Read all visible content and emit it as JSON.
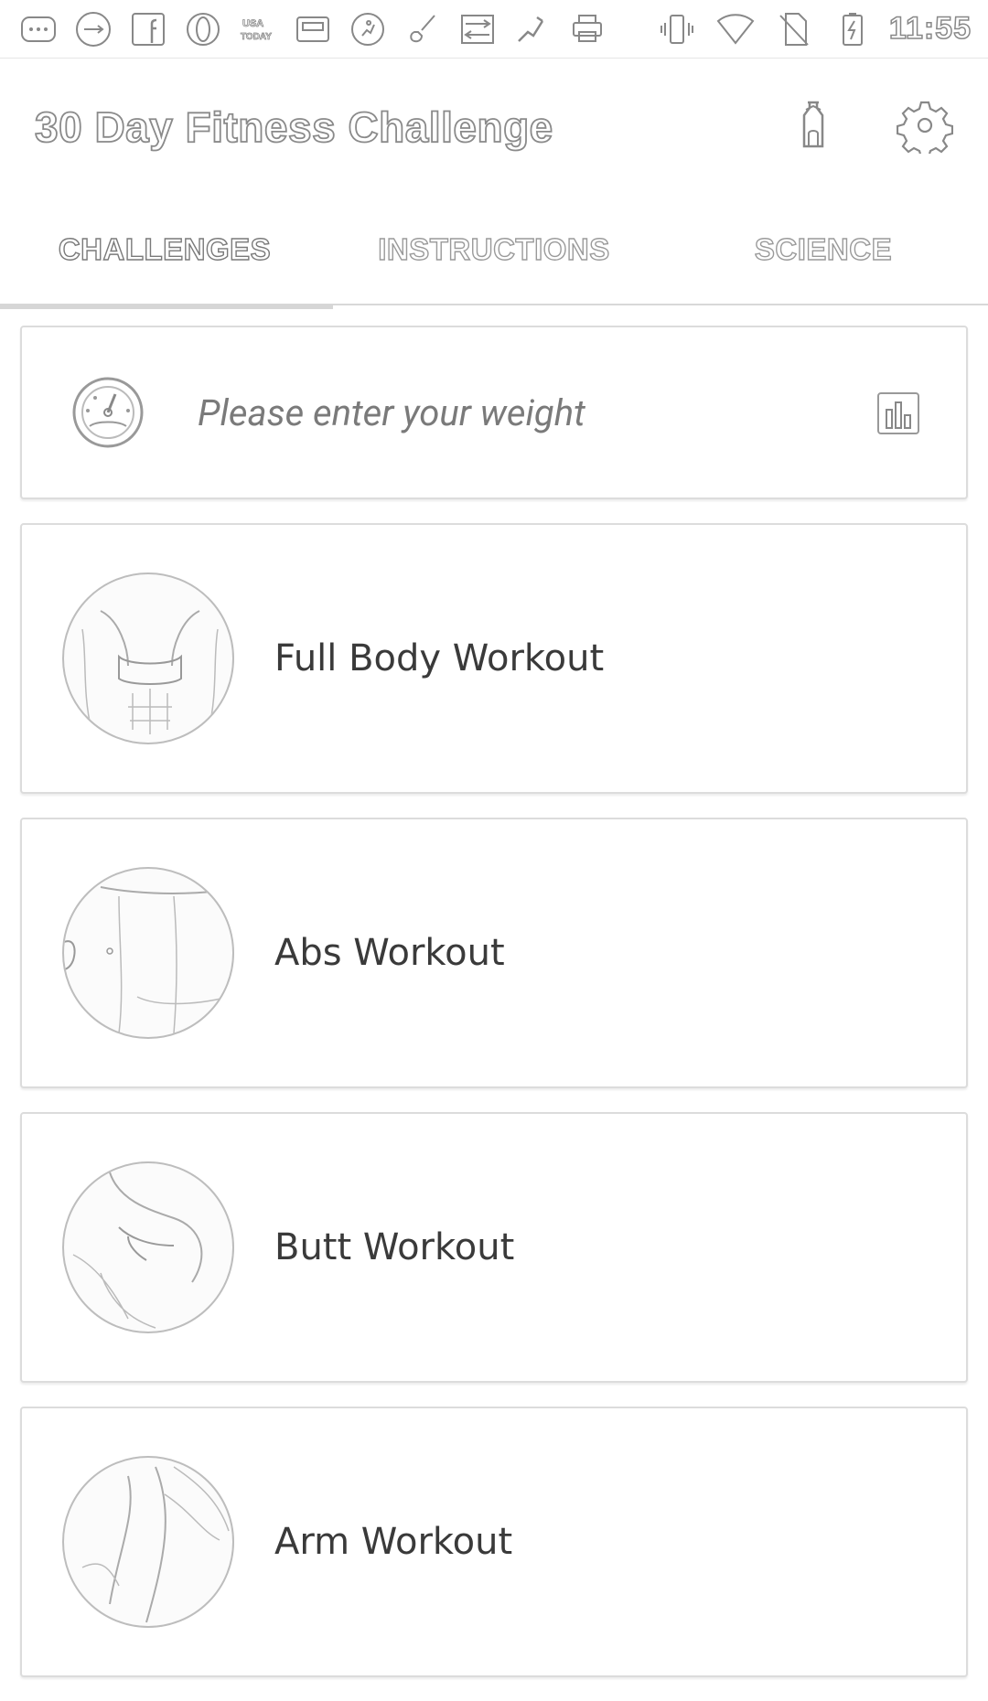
{
  "status_bar": {
    "time": "11:55",
    "left_icons": [
      "more-icon",
      "usb-icon",
      "facebook-icon",
      "opera-icon",
      "usa-today-icon",
      "cassette-icon",
      "runner-icon",
      "guitar-icon",
      "transfer-icon",
      "fitness-icon",
      "printer-icon"
    ],
    "right_icons": [
      "vibrate-icon",
      "wifi-icon",
      "no-sim-icon",
      "battery-icon"
    ]
  },
  "app_bar": {
    "title": "30 Day Fitness Challenge"
  },
  "tabs": [
    {
      "label": "CHALLENGES",
      "active": true
    },
    {
      "label": "INSTRUCTIONS",
      "active": false
    },
    {
      "label": "SCIENCE",
      "active": false
    }
  ],
  "weight": {
    "placeholder": "Please enter your weight"
  },
  "workouts": [
    {
      "title": "Full Body Workout"
    },
    {
      "title": "Abs Workout"
    },
    {
      "title": "Butt Workout"
    },
    {
      "title": "Arm Workout"
    }
  ]
}
